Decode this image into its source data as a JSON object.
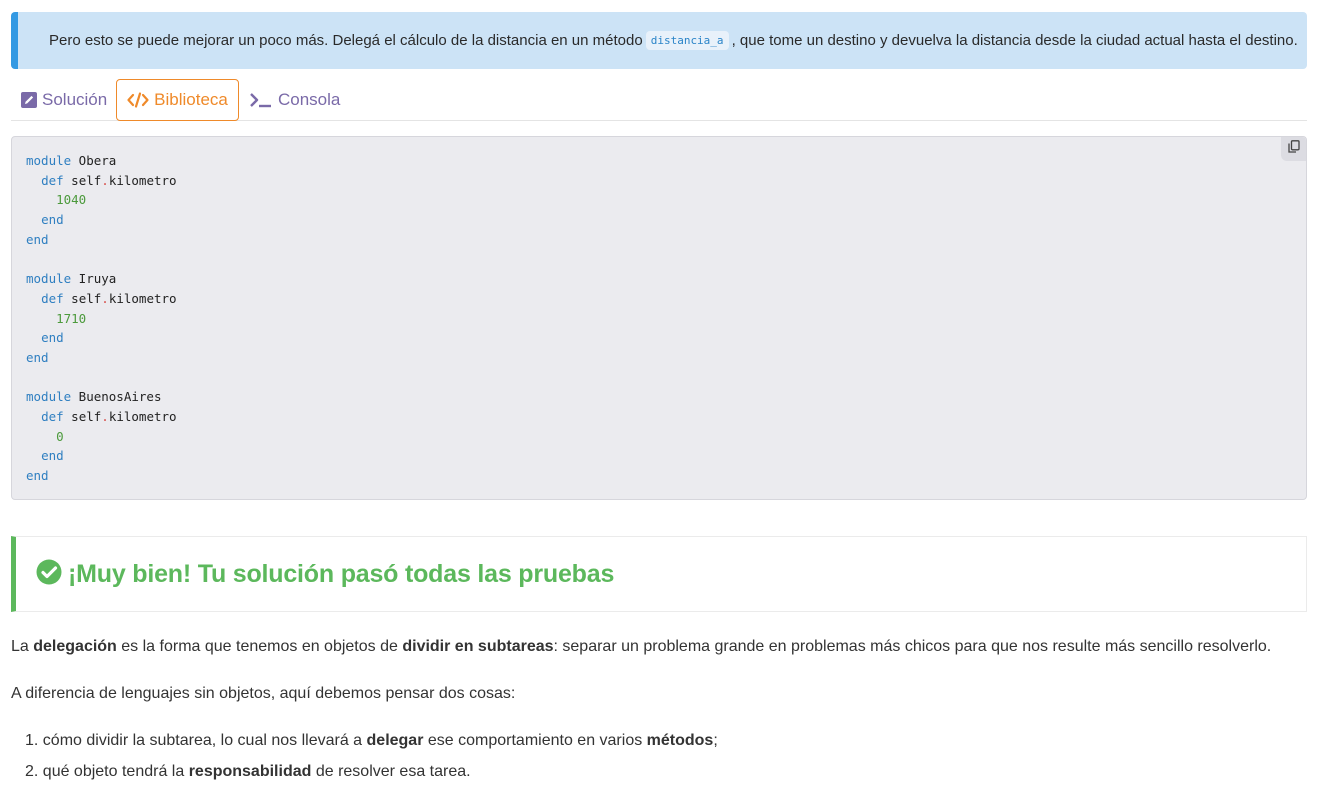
{
  "info": {
    "text_before": "Pero esto se puede mejorar un poco más. Delegá el cálculo de la distancia en un método",
    "code": "distancia_a",
    "text_after": ", que tome un destino y devuelva la distancia desde la ciudad actual hasta el destino."
  },
  "tabs": [
    {
      "label": "Solución",
      "icon": "pencil-square-icon"
    },
    {
      "label": "Biblioteca",
      "icon": "code-icon",
      "active": true
    },
    {
      "label": "Consola",
      "icon": "terminal-icon"
    }
  ],
  "code_lines": [
    {
      "kw": "module",
      "rest": " Obera"
    },
    {
      "indent": "  ",
      "kw": "def",
      "obj": " self",
      "dot": ".",
      "meth": "kilometro"
    },
    {
      "indent": "    ",
      "num": "1040"
    },
    {
      "indent": "  ",
      "kw": "end"
    },
    {
      "kw": "end"
    },
    {},
    {
      "kw": "module",
      "rest": " Iruya"
    },
    {
      "indent": "  ",
      "kw": "def",
      "obj": " self",
      "dot": ".",
      "meth": "kilometro"
    },
    {
      "indent": "    ",
      "num": "1710"
    },
    {
      "indent": "  ",
      "kw": "end"
    },
    {
      "kw": "end"
    },
    {},
    {
      "kw": "module",
      "rest": " BuenosAires"
    },
    {
      "indent": "  ",
      "kw": "def",
      "obj": " self",
      "dot": ".",
      "meth": "kilometro"
    },
    {
      "indent": "    ",
      "num": "0"
    },
    {
      "indent": "  ",
      "kw": "end"
    },
    {
      "kw": "end"
    }
  ],
  "success": {
    "title": "¡Muy bien! Tu solución pasó todas las pruebas"
  },
  "explanation": {
    "p1": {
      "a": "La ",
      "b1": "delegación",
      "c": " es la forma que tenemos en objetos de ",
      "b2": "dividir en subtareas",
      "d": ": separar un problema grande en problemas más chicos para que nos resulte más sencillo resolverlo."
    },
    "p2": "A diferencia de lenguajes sin objetos, aquí debemos pensar dos cosas:",
    "list": [
      {
        "num": "1.",
        "a": " cómo dividir la subtarea, lo cual nos llevará a ",
        "b1": "delegar",
        "c": " ese comportamiento en varios ",
        "b2": "métodos",
        "d": ";"
      },
      {
        "num": "2.",
        "a": " qué objeto tendrá la ",
        "b1": "responsabilidad",
        "c": " de resolver esa tarea.",
        "b2": "",
        "d": ""
      }
    ]
  },
  "colors": {
    "accent_orange": "#ef8a2a",
    "info_blue": "#3399e3",
    "success_green": "#5cb85c",
    "tab_purple": "#7a6aa8"
  }
}
